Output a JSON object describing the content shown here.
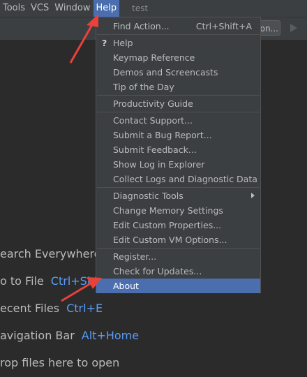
{
  "menubar": {
    "items": [
      {
        "label": "Tools"
      },
      {
        "label": "VCS"
      },
      {
        "label": "Window"
      },
      {
        "label": "Help"
      }
    ],
    "project_name": "test"
  },
  "toolbar": {
    "run_config_label": "on...",
    "run_icon": "play-icon"
  },
  "welcome": {
    "items": [
      {
        "label": "earch Everywhere",
        "shortcut": ""
      },
      {
        "label": "o to File",
        "shortcut": "Ctrl+Shift"
      },
      {
        "label": "ecent Files",
        "shortcut": "Ctrl+E"
      },
      {
        "label": "avigation Bar",
        "shortcut": "Alt+Home"
      },
      {
        "label": "rop files here to open",
        "shortcut": ""
      }
    ]
  },
  "help_menu": {
    "items": [
      {
        "label": "Find Action...",
        "shortcut": "Ctrl+Shift+A"
      },
      {
        "label": "Help",
        "icon": "?"
      },
      {
        "label": "Keymap Reference"
      },
      {
        "label": "Demos and Screencasts"
      },
      {
        "label": "Tip of the Day"
      },
      {
        "label": "Productivity Guide"
      },
      {
        "label": "Contact Support..."
      },
      {
        "label": "Submit a Bug Report..."
      },
      {
        "label": "Submit Feedback..."
      },
      {
        "label": "Show Log in Explorer"
      },
      {
        "label": "Collect Logs and Diagnostic Data"
      },
      {
        "label": "Diagnostic Tools"
      },
      {
        "label": "Change Memory Settings"
      },
      {
        "label": "Edit Custom Properties..."
      },
      {
        "label": "Edit Custom VM Options..."
      },
      {
        "label": "Register..."
      },
      {
        "label": "Check for Updates..."
      },
      {
        "label": "About"
      }
    ],
    "selected": "About"
  },
  "colors": {
    "menu_bg": "#3c3f41",
    "selection": "#4b6eaf",
    "shortcut_blue": "#589df6",
    "annotation_red": "#e8423a"
  }
}
